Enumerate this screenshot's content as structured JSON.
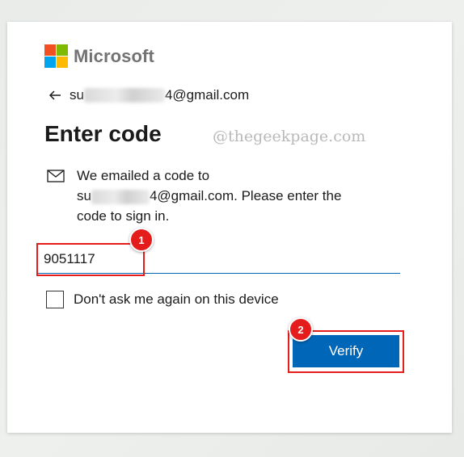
{
  "brand": {
    "logo_text": "Microsoft",
    "colors": {
      "red": "#f25022",
      "green": "#7fba00",
      "blue": "#00a4ef",
      "yellow": "#ffb900"
    }
  },
  "account": {
    "email_prefix": "su",
    "email_suffix": "4@gmail.com"
  },
  "title": "Enter code",
  "watermark": "@thegeekpage.com",
  "message": {
    "line1": "We emailed a code to",
    "email_prefix": "su",
    "line2_rest": "4@gmail.com. Please enter the",
    "line3": "code to sign in."
  },
  "code_input": {
    "value": "9051117",
    "placeholder": ""
  },
  "checkbox": {
    "label": "Don't ask me again on this device",
    "checked": false
  },
  "verify_button": {
    "label": "Verify",
    "color": "#0067b8"
  },
  "annotations": {
    "step1": "1",
    "step2": "2",
    "color": "#e41c1c"
  },
  "icons": {
    "back": "back-arrow-icon",
    "mail": "mail-icon"
  }
}
